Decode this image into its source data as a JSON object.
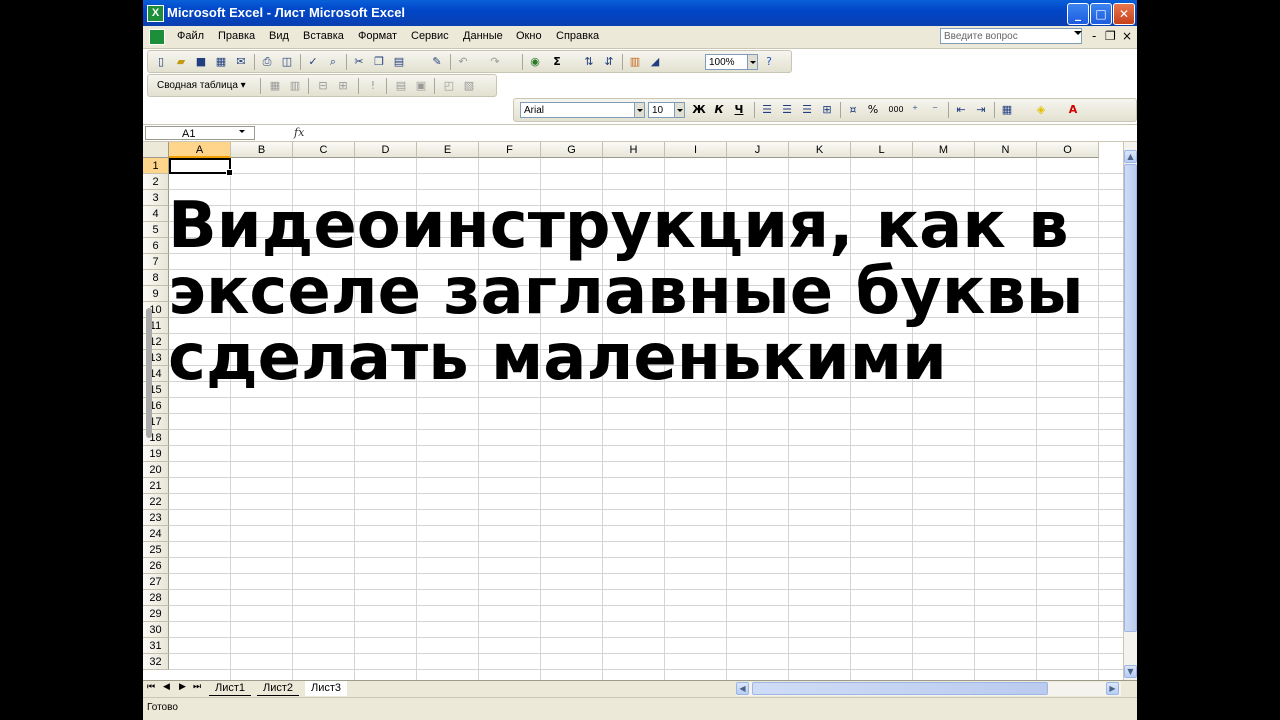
{
  "window": {
    "title": "Microsoft Excel - Лист Microsoft Excel",
    "app_icon": "excel-icon",
    "minimize": "_",
    "maximize": "□",
    "close": "✕"
  },
  "menu": {
    "items": [
      "Файл",
      "Правка",
      "Вид",
      "Вставка",
      "Формат",
      "Сервис",
      "Данные",
      "Окно",
      "Справка"
    ],
    "help_placeholder": "Введите вопрос",
    "mdi_min": "-",
    "mdi_restore": "❐",
    "mdi_close": "×"
  },
  "standard_toolbar": {
    "zoom": "100%",
    "autosum": "Σ"
  },
  "pivot_toolbar": {
    "label": "Сводная таблица ▾"
  },
  "format_toolbar": {
    "font": "Arial",
    "size": "10",
    "bold": "Ж",
    "italic": "К",
    "underline": "Ч",
    "percent": "%",
    "thousands": "000"
  },
  "formula_bar": {
    "cell_ref": "A1",
    "fx": "fx",
    "value": ""
  },
  "grid": {
    "columns": [
      "A",
      "B",
      "C",
      "D",
      "E",
      "F",
      "G",
      "H",
      "I",
      "J",
      "K",
      "L",
      "M",
      "N",
      "O"
    ],
    "rows": [
      "1",
      "2",
      "3",
      "4",
      "5",
      "6",
      "7",
      "8",
      "9",
      "10",
      "11",
      "12",
      "13",
      "14",
      "15",
      "16",
      "17",
      "18",
      "19",
      "20",
      "21",
      "22",
      "23",
      "24",
      "25",
      "26",
      "27",
      "28",
      "29",
      "30",
      "31",
      "32"
    ],
    "selected_cell": "A1"
  },
  "overlay_text": [
    "Видеоинструкция, как в",
    "экселе заглавные буквы",
    "сделать маленькими"
  ],
  "sheets": {
    "tabs": [
      "Лист1",
      "Лист2",
      "Лист3"
    ],
    "active": "Лист3"
  },
  "status": {
    "text": "Готово"
  }
}
